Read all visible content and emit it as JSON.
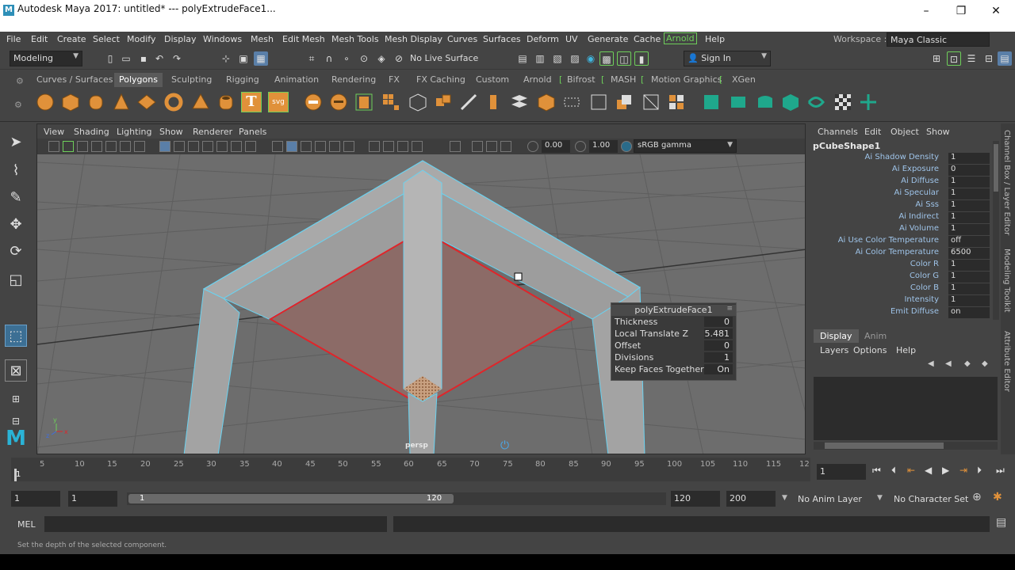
{
  "window": {
    "title": "Autodesk Maya 2017: untitled*   ---   polyExtrudeFace1...",
    "logo": "M",
    "controls": [
      "–",
      "❐",
      "✕"
    ]
  },
  "menus": [
    "File",
    "Edit",
    "Create",
    "Select",
    "Modify",
    "Display",
    "Windows",
    "Mesh",
    "Edit Mesh",
    "Mesh Tools",
    "Mesh Display",
    "Curves",
    "Surfaces",
    "Deform",
    "UV",
    "Generate",
    "Cache",
    "Arnold",
    "Help"
  ],
  "workspace": {
    "label": "Workspace :",
    "value": "Maya Classic"
  },
  "status": {
    "mode": "Modeling",
    "live_surface": "No Live Surface",
    "sign_in": "Sign In"
  },
  "shelf_tabs": [
    "Curves / Surfaces",
    "Polygons",
    "Sculpting",
    "Rigging",
    "Animation",
    "Rendering",
    "FX",
    "FX Caching",
    "Custom",
    "Arnold",
    "Bifrost",
    "MASH",
    "Motion Graphics",
    "XGen"
  ],
  "active_shelf_tab": "Polygons",
  "shelf_text_icons": {
    "text": "T",
    "svg": "svg"
  },
  "viewport": {
    "menus": [
      "View",
      "Shading",
      "Lighting",
      "Show",
      "Renderer",
      "Panels"
    ],
    "exposure": "0.00",
    "gamma": "1.00",
    "color_space": "sRGB gamma",
    "camera": "persp",
    "axis_labels": [
      "y",
      "z",
      "x"
    ]
  },
  "popup": {
    "title": "polyExtrudeFace1",
    "rows": [
      {
        "label": "Thickness",
        "value": "0"
      },
      {
        "label": "Local Translate Z",
        "value": "5.481"
      },
      {
        "label": "Offset",
        "value": "0"
      },
      {
        "label": "Divisions",
        "value": "1"
      },
      {
        "label": "Keep Faces Together",
        "value": "On"
      }
    ]
  },
  "channel_box": {
    "menus": [
      "Channels",
      "Edit",
      "Object",
      "Show"
    ],
    "object": "pCubeShape1",
    "attributes": [
      {
        "label": "Ai Shadow Density",
        "value": "1"
      },
      {
        "label": "Ai Exposure",
        "value": "0"
      },
      {
        "label": "Ai Diffuse",
        "value": "1"
      },
      {
        "label": "Ai Specular",
        "value": "1"
      },
      {
        "label": "Ai Sss",
        "value": "1"
      },
      {
        "label": "Ai Indirect",
        "value": "1"
      },
      {
        "label": "Ai Volume",
        "value": "1"
      },
      {
        "label": "Ai Use Color Temperature",
        "value": "off"
      },
      {
        "label": "Ai Color Temperature",
        "value": "6500"
      },
      {
        "label": "Color R",
        "value": "1"
      },
      {
        "label": "Color G",
        "value": "1"
      },
      {
        "label": "Color B",
        "value": "1"
      },
      {
        "label": "Intensity",
        "value": "1"
      },
      {
        "label": "Emit Diffuse",
        "value": "on"
      }
    ]
  },
  "layer_editor": {
    "tabs": [
      "Display",
      "Anim"
    ],
    "menus": [
      "Layers",
      "Options",
      "Help"
    ]
  },
  "side_tabs": [
    "Channel Box / Layer Editor",
    "Modeling Toolkit",
    "Attribute Editor"
  ],
  "timeline": {
    "ticks": [
      "1",
      "5",
      "10",
      "15",
      "20",
      "25",
      "30",
      "35",
      "40",
      "45",
      "50",
      "55",
      "60",
      "65",
      "70",
      "75",
      "80",
      "85",
      "90",
      "95",
      "100",
      "105",
      "110",
      "115",
      "12"
    ],
    "current_frame": "1",
    "range_start": "1",
    "range_start2": "1",
    "slider_start": "1",
    "slider_end": "120",
    "end": "120",
    "max_end": "200",
    "anim_layer": "No Anim Layer",
    "character_set": "No Character Set"
  },
  "mel": {
    "label": "MEL"
  },
  "help_line": "Set the depth of the selected component.",
  "colors": {
    "accent_green": "#6ecf5a",
    "selection_red": "#e0252a",
    "wire_cyan": "#6ad2f0",
    "label_blue": "#9ec3e8"
  }
}
